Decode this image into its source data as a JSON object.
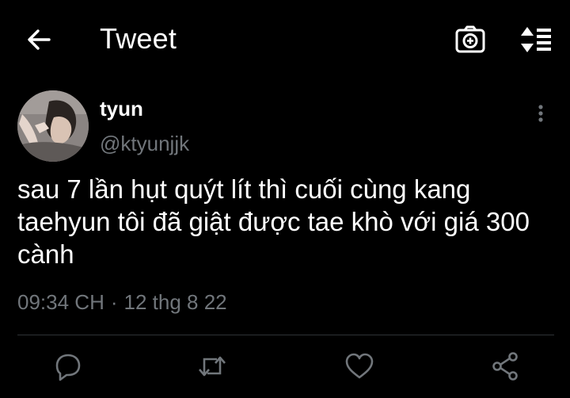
{
  "header": {
    "title": "Tweet",
    "back_icon": "arrow-left-icon",
    "camera_icon": "camera-icon",
    "sort_icon": "sort-list-icon"
  },
  "tweet": {
    "author_name": "tyun",
    "author_handle": "@ktyunjjk",
    "text": "sau 7 lần hụt quýt lít thì cuối cùng kang taehyun tôi đã giật được tae khò với giá 300 cành",
    "time": "09:34 CH",
    "separator": "·",
    "date": "12 thg 8 22"
  },
  "actions": {
    "reply_icon": "reply-bubble-icon",
    "retweet_icon": "retweet-icon",
    "like_icon": "heart-icon",
    "share_icon": "share-icon"
  },
  "colors": {
    "background": "#000000",
    "text": "#ffffff",
    "muted": "#71767b",
    "divider": "#2f3336"
  }
}
